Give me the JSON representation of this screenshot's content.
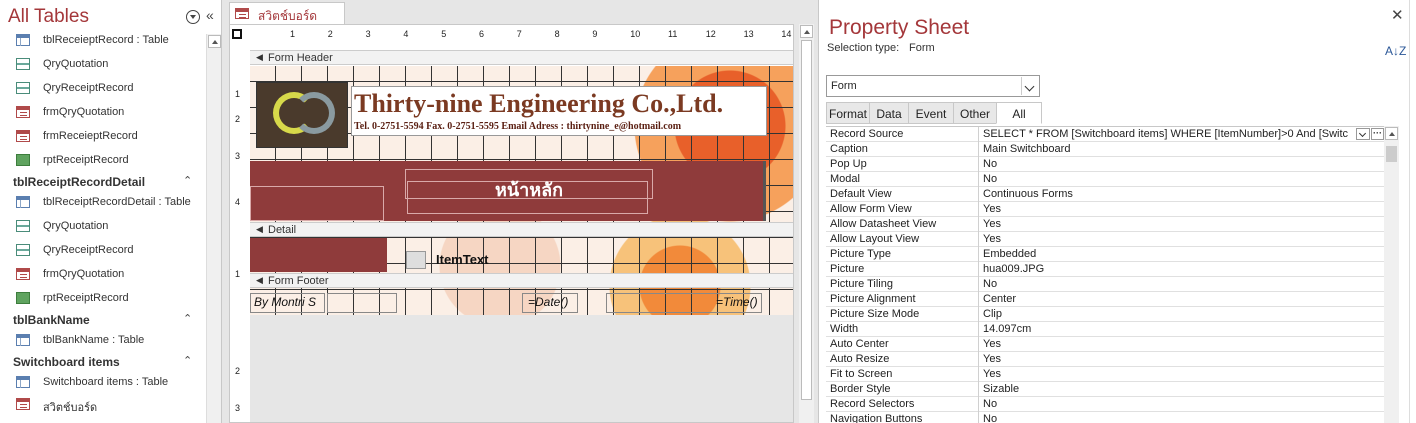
{
  "nav": {
    "title": "All Tables",
    "groups": [
      {
        "label": "tblReceiptRecordDetail"
      },
      {
        "label": "tblBankName"
      },
      {
        "label": "Switchboard items"
      }
    ],
    "items": [
      {
        "label": "tblReceieptRecord : Table",
        "icon": "table-icon"
      },
      {
        "label": "QryQuotation",
        "icon": "query-icon"
      },
      {
        "label": "QryReceiptRecord",
        "icon": "query-icon"
      },
      {
        "label": "frmQryQuotation",
        "icon": "form-icon"
      },
      {
        "label": "frmReceieptRecord",
        "icon": "form-icon"
      },
      {
        "label": "rptReceiptRecord",
        "icon": "report-icon"
      },
      {
        "label": "tblReceiptRecordDetail : Table",
        "icon": "table-icon"
      },
      {
        "label": "QryQuotation",
        "icon": "query-icon"
      },
      {
        "label": "QryReceiptRecord",
        "icon": "query-icon"
      },
      {
        "label": "frmQryQuotation",
        "icon": "form-icon"
      },
      {
        "label": "rptReceiptRecord",
        "icon": "report-icon"
      },
      {
        "label": "tblBankName : Table",
        "icon": "table-icon"
      },
      {
        "label": "Switchboard items : Table",
        "icon": "table-icon"
      },
      {
        "label": "สวิตช์บอร์ด",
        "icon": "form-icon"
      }
    ]
  },
  "document": {
    "tab_label": "สวิตช์บอร์ด",
    "ruler_numbers": [
      "1",
      "2",
      "3",
      "4",
      "5",
      "6",
      "7",
      "8",
      "9",
      "10",
      "11",
      "12",
      "13",
      "14"
    ],
    "vruler_numbers": [
      "1",
      "2",
      "3",
      "4",
      "1",
      "2",
      "3"
    ],
    "sections": {
      "header": "Form Header",
      "detail": "Detail",
      "footer": "Form Footer"
    },
    "company_name": "Thirty-nine Engineering Co.,Ltd.",
    "company_contact": "Tel. 0-2751-5594  Fax. 0-2751-5595  Email Adress : thirtynine_e@hotmail.com",
    "title": "หน้าหลัก",
    "detail_text": "ItemText",
    "footer_by": "By Montri S",
    "footer_date": "=Date()",
    "footer_time": "=Time()"
  },
  "property_sheet": {
    "title": "Property Sheet",
    "selection_type_label": "Selection type:",
    "selection_type_value": "Form",
    "object_select": "Form",
    "tabs": [
      "Format",
      "Data",
      "Event",
      "Other",
      "All"
    ],
    "active_tab": "All",
    "properties": [
      {
        "name": "Record Source",
        "value": "SELECT * FROM [Switchboard items] WHERE [ItemNumber]>0 And [Switc"
      },
      {
        "name": "Caption",
        "value": "Main Switchboard"
      },
      {
        "name": "Pop Up",
        "value": "No"
      },
      {
        "name": "Modal",
        "value": "No"
      },
      {
        "name": "Default View",
        "value": "Continuous Forms"
      },
      {
        "name": "Allow Form View",
        "value": "Yes"
      },
      {
        "name": "Allow Datasheet View",
        "value": "Yes"
      },
      {
        "name": "Allow Layout View",
        "value": "Yes"
      },
      {
        "name": "Picture Type",
        "value": "Embedded"
      },
      {
        "name": "Picture",
        "value": "hua009.JPG"
      },
      {
        "name": "Picture Tiling",
        "value": "No"
      },
      {
        "name": "Picture Alignment",
        "value": "Center"
      },
      {
        "name": "Picture Size Mode",
        "value": "Clip"
      },
      {
        "name": "Width",
        "value": "14.097cm"
      },
      {
        "name": "Auto Center",
        "value": "Yes"
      },
      {
        "name": "Auto Resize",
        "value": "Yes"
      },
      {
        "name": "Fit to Screen",
        "value": "Yes"
      },
      {
        "name": "Border Style",
        "value": "Sizable"
      },
      {
        "name": "Record Selectors",
        "value": "No"
      },
      {
        "name": "Navigation Buttons",
        "value": "No"
      }
    ]
  },
  "colors": {
    "accent": "#a4373a",
    "title_band": "#8f3b3b"
  }
}
